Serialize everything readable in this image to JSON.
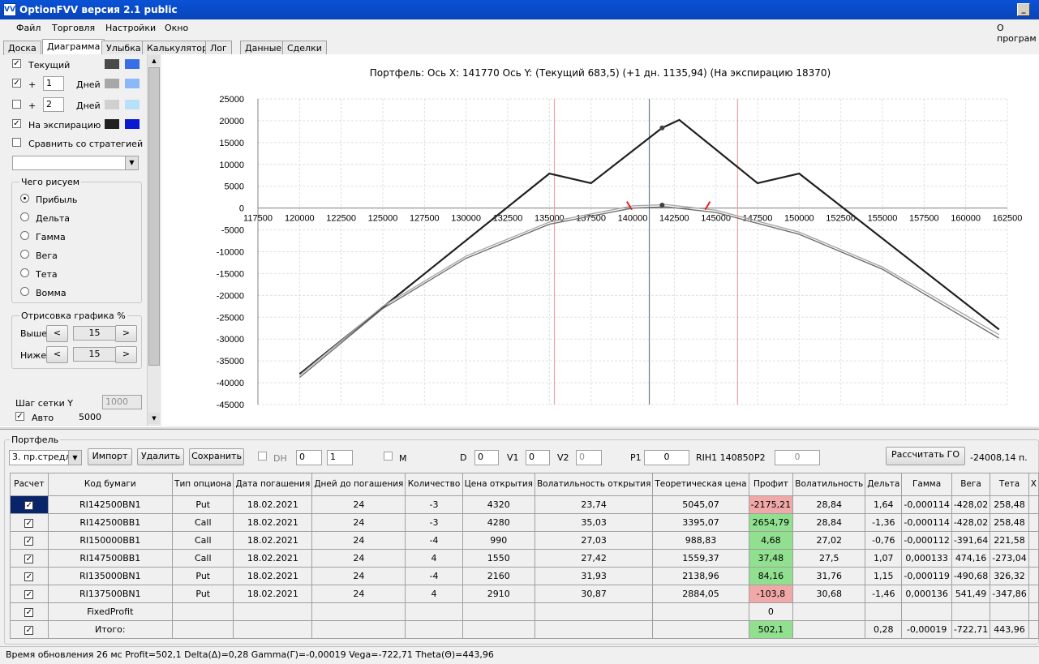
{
  "window": {
    "title": "OptionFVV версия 2.1 public",
    "icon": "app-icon",
    "min_label": "_"
  },
  "menu": [
    "Файл",
    "Торговля",
    "Настройки",
    "Окно"
  ],
  "menu_right": "О програм",
  "tabs": [
    "Доска",
    "Диаграмма",
    "Улыбка",
    "Калькулятор",
    "Лог",
    "Данные",
    "Сделки"
  ],
  "left": {
    "current": {
      "label": "Текущий",
      "checked": true,
      "colors": [
        "#4a4a4a",
        "#3a6ee8"
      ]
    },
    "plus1": {
      "plus": "+",
      "value": "1",
      "unit": "Дней",
      "checked": true,
      "colors": [
        "#a8a8a8",
        "#8ab8f8"
      ]
    },
    "plus2": {
      "plus": "+",
      "value": "2",
      "unit": "Дней",
      "checked": false,
      "colors": [
        "#d0d0d0",
        "#b8e0f8"
      ]
    },
    "expiry": {
      "label": "На экспирацию",
      "checked": true,
      "colors": [
        "#202020",
        "#0a1ad0"
      ]
    },
    "compare": {
      "label": "Сравнить со стратегией",
      "checked": false
    },
    "compare_select": "",
    "what_group": "Чего рисуем",
    "what": [
      {
        "label": "Прибыль",
        "on": true
      },
      {
        "label": "Дельта",
        "on": false
      },
      {
        "label": "Гамма",
        "on": false
      },
      {
        "label": "Вега",
        "on": false
      },
      {
        "label": "Тета",
        "on": false
      },
      {
        "label": "Вомма",
        "on": false
      }
    ],
    "draw_group": "Отрисовка графика %",
    "above": {
      "label": "Выше",
      "value": "15"
    },
    "below": {
      "label": "Ниже",
      "value": "15"
    },
    "lt": "<",
    "gt": ">",
    "grid_step_label": "Шаг сетки Y",
    "grid_step_value": "1000",
    "auto": {
      "label": "Авто",
      "value": "5000",
      "checked": true
    }
  },
  "chart_header": {
    "title": "Портфель: Ось X: 141770 Ось Y: (Текущий 683,5) (+1 дн. 1135,94) (На экспирацию 18370)"
  },
  "chart_data": {
    "type": "line",
    "title": "Портфель: Ось X: 141770 Ось Y: (Текущий 683,5) (+1 дн. 1135,94) (На экспирацию 18370)",
    "xlim": [
      117500,
      162500
    ],
    "ylim": [
      -45000,
      25000
    ],
    "xticks": [
      "117500",
      "120000",
      "122500",
      "125000",
      "127500",
      "130000",
      "132500",
      "135000",
      "137500",
      "140000",
      "142500",
      "145000",
      "147500",
      "150000",
      "152500",
      "155000",
      "157500",
      "160000",
      "162500"
    ],
    "yticks": [
      "25000",
      "20000",
      "15000",
      "10000",
      "5000",
      "0",
      "-5000",
      "-10000",
      "-15000",
      "-20000",
      "-25000",
      "-30000",
      "-35000",
      "-40000",
      "-45000"
    ],
    "grid": true,
    "vlines": [
      {
        "x": 135300,
        "color": "#f0a0a8"
      },
      {
        "x": 141000,
        "color": "#6a7a90"
      },
      {
        "x": 146300,
        "color": "#f0a0a8"
      }
    ],
    "series": [
      {
        "color": "#202020",
        "x": [
          120000,
          135000,
          137500,
          141770,
          142800,
          147500,
          150000,
          162000
        ],
        "y": [
          -38000,
          7900,
          5700,
          18370,
          20200,
          5700,
          7900,
          -27800
        ]
      },
      {
        "color": "#a8a8a8",
        "x": [
          120000,
          125000,
          130000,
          135000,
          140000,
          142000,
          145000,
          150000,
          155000,
          162000
        ],
        "y": [
          -38300,
          -22500,
          -11000,
          -3200,
          500,
          800,
          -500,
          -5500,
          -13500,
          -29000
        ]
      },
      {
        "color": "#707070",
        "x": [
          120000,
          125000,
          130000,
          135000,
          140000,
          142000,
          145000,
          150000,
          155000,
          162000
        ],
        "y": [
          -38800,
          -23000,
          -11500,
          -3700,
          0,
          300,
          -1000,
          -6000,
          -14000,
          -29800
        ]
      }
    ],
    "markers": [
      {
        "x": 141770,
        "y": 18370
      },
      {
        "x": 141770,
        "y": 683.5
      }
    ],
    "ticks_red": [
      {
        "x": 139800,
        "y": 0
      },
      {
        "x": 144500,
        "y": 0
      }
    ]
  },
  "portfolio": {
    "group": "Портфель",
    "select": "3. пр.стредл",
    "import": "Импорт",
    "delete": "Удалить",
    "save": "Сохранить",
    "dh": "DH",
    "dh_a": "0",
    "dh_b": "1",
    "m": "M",
    "d_label": "D",
    "d": "0",
    "v1_label": "V1",
    "v1": "0",
    "v2_label": "V2",
    "v2": "0",
    "p1_label": "P1",
    "p1": "0",
    "instr": "RIH1 140850",
    "p2_label": "P2",
    "p2": "0",
    "calc_go": "Рассчитать ГО",
    "go_value": "-24008,14 п."
  },
  "table": {
    "headers": [
      "Расчет",
      "Код бумаги",
      "Тип опциона",
      "Дата погашения",
      "Дней до погашения",
      "Количество",
      "Цена открытия",
      "Волатильность открытия",
      "Теоретическая цена",
      "Профит",
      "Волатильность",
      "Дельта",
      "Гамма",
      "Вега",
      "Тета",
      "X"
    ],
    "rows": [
      [
        "RI142500BN1",
        "Put",
        "18.02.2021",
        "24",
        "-3",
        "4320",
        "23,74",
        "5045,07",
        "-2175,21",
        "28,84",
        "1,64",
        "-0,000114",
        "-428,02",
        "258,48",
        "neg"
      ],
      [
        "RI142500BB1",
        "Call",
        "18.02.2021",
        "24",
        "-3",
        "4280",
        "35,03",
        "3395,07",
        "2654,79",
        "28,84",
        "-1,36",
        "-0,000114",
        "-428,02",
        "258,48",
        "pos"
      ],
      [
        "RI150000BB1",
        "Call",
        "18.02.2021",
        "24",
        "-4",
        "990",
        "27,03",
        "988,83",
        "4,68",
        "27,02",
        "-0,76",
        "-0,000112",
        "-391,64",
        "221,58",
        "pos"
      ],
      [
        "RI147500BB1",
        "Call",
        "18.02.2021",
        "24",
        "4",
        "1550",
        "27,42",
        "1559,37",
        "37,48",
        "27,5",
        "1,07",
        "0,000133",
        "474,16",
        "-273,04",
        "pos"
      ],
      [
        "RI135000BN1",
        "Put",
        "18.02.2021",
        "24",
        "-4",
        "2160",
        "31,93",
        "2138,96",
        "84,16",
        "31,76",
        "1,15",
        "-0,000119",
        "-490,68",
        "326,32",
        "pos"
      ],
      [
        "RI137500BN1",
        "Put",
        "18.02.2021",
        "24",
        "4",
        "2910",
        "30,87",
        "2884,05",
        "-103,8",
        "30,68",
        "-1,46",
        "0,000136",
        "541,49",
        "-347,86",
        "neg"
      ]
    ],
    "fixed": {
      "name": "FixedProfit",
      "profit": "0"
    },
    "total": {
      "name": "Итого:",
      "profit": "502,1",
      "delta": "0,28",
      "gamma": "-0,00019",
      "vega": "-722,71",
      "theta": "443,96"
    }
  },
  "status": "Время обновления 26 мс  Profit=502,1 Delta(Δ)=0,28 Gamma(Γ)=-0,00019 Vega=-722,71 Theta(Θ)=443,96"
}
